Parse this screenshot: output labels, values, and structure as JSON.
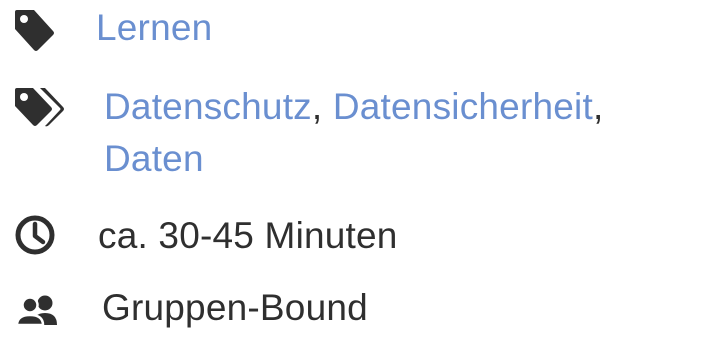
{
  "meta": {
    "category_icon": "tag-icon",
    "tags_icon": "tags-icon",
    "duration_icon": "clock-icon",
    "group_icon": "users-icon",
    "link_color": "#6a8fd0",
    "text_color": "#2f2f2f"
  },
  "category": {
    "label": "Lernen"
  },
  "tags": {
    "items": [
      "Datenschutz",
      "Datensicherheit",
      "Daten"
    ],
    "separator": ","
  },
  "duration": {
    "text": "ca. 30-45 Minuten"
  },
  "group": {
    "text": "Gruppen-Bound"
  }
}
